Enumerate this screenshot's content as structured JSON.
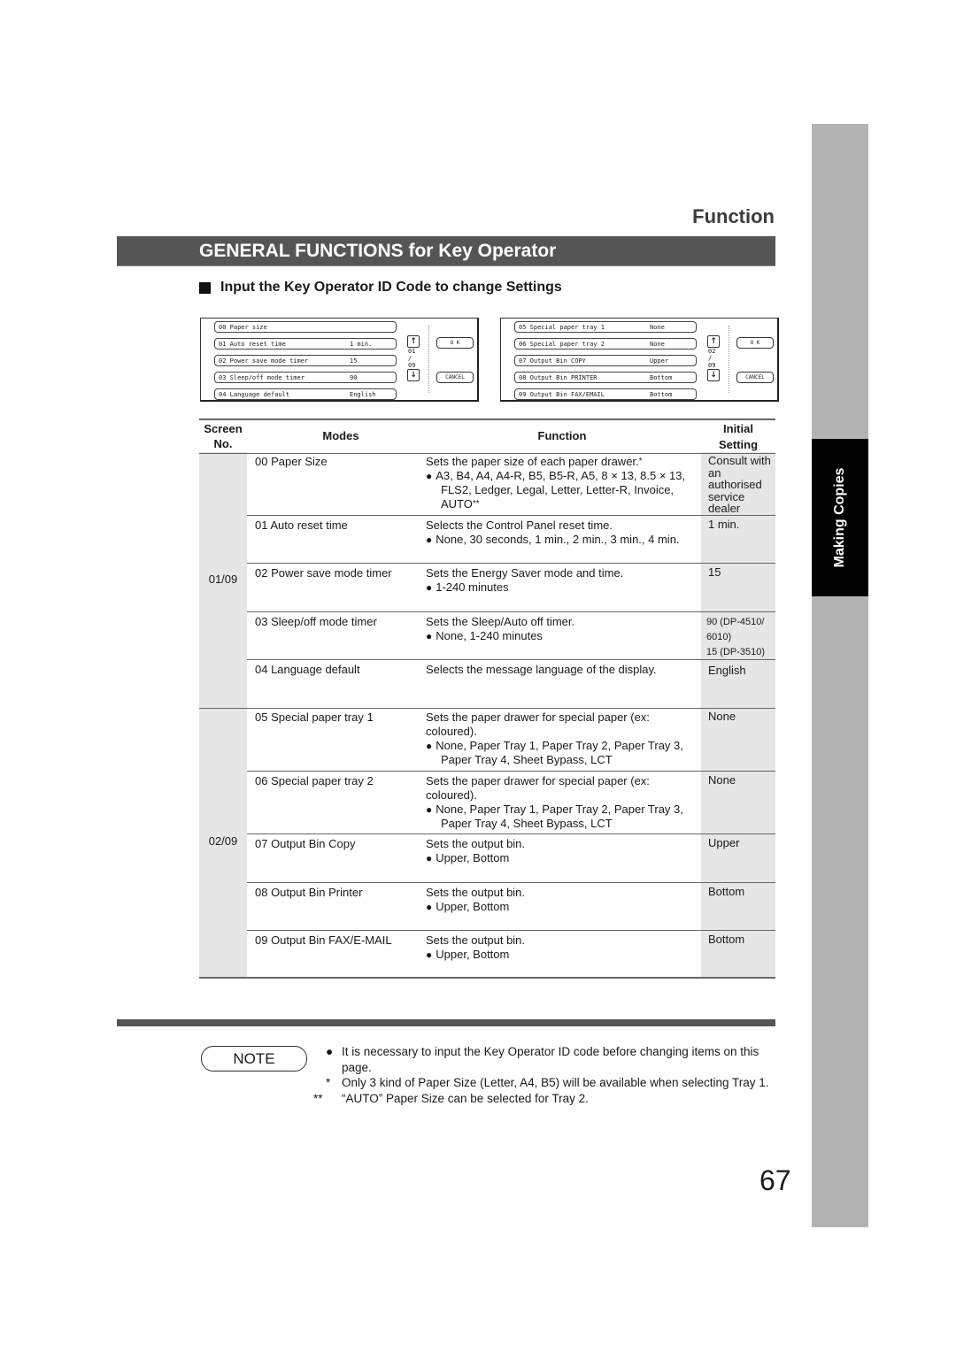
{
  "sidebar": {
    "tab_label": "Making Copies",
    "colors": {
      "tab": "#000000",
      "band": "#b3b3b3"
    }
  },
  "header": {
    "section_label": "Function",
    "title": "GENERAL FUNCTIONS for Key Operator",
    "subheading": "Input the Key Operator ID Code to change Settings"
  },
  "screens": [
    {
      "rows": [
        {
          "text": "00  Paper size",
          "value": ""
        },
        {
          "text": "01  Auto reset time",
          "value": "1 min."
        },
        {
          "text": "02  Power save mode timer",
          "value": "15"
        },
        {
          "text": "03  Sleep/off mode timer",
          "value": "90"
        },
        {
          "text": "04  Language default",
          "value": "English"
        }
      ],
      "page_current": "01",
      "page_total": "09",
      "ok_label": "O K",
      "cancel_label": "CANCEL"
    },
    {
      "rows": [
        {
          "text": "05  Special paper tray 1",
          "value": "None"
        },
        {
          "text": "06  Special paper tray 2",
          "value": "None"
        },
        {
          "text": "07  Output Bin COPY",
          "value": "Upper"
        },
        {
          "text": "08  Output Bin PRINTER",
          "value": "Bottom"
        },
        {
          "text": "09  Output Bin FAX/EMAIL",
          "value": "Bottom"
        }
      ],
      "page_current": "02",
      "page_total": "09",
      "ok_label": "O K",
      "cancel_label": "CANCEL"
    }
  ],
  "table": {
    "headers": {
      "screen_line1": "Screen",
      "screen_line2": "No.",
      "modes": "Modes",
      "function": "Function",
      "initial_line1": "Initial",
      "initial_line2": "Setting"
    },
    "groups": [
      {
        "screen_no": "01/09"
      },
      {
        "screen_no": "02/09"
      }
    ],
    "rows": [
      {
        "mode": "00 Paper Size",
        "func": "Sets the paper size of each paper drawer.",
        "func_mark": "*",
        "options": "A3, B4, A4, A4-R, B5, B5-R, A5, 8 × 13, 8.5 × 13, FLS2, Ledger, Legal, Letter, Letter-R, Invoice, AUTO",
        "options_mark": "**",
        "initial": "Consult with an authorised service dealer"
      },
      {
        "mode": "01 Auto reset time",
        "func": "Selects the Control Panel reset time.",
        "options": "None, 30 seconds, 1 min., 2 min., 3 min., 4 min.",
        "initial": "1 min."
      },
      {
        "mode": "02 Power save mode timer",
        "func": "Sets the Energy Saver mode and time.",
        "options": "1-240 minutes",
        "initial": "15"
      },
      {
        "mode": "03 Sleep/off mode timer",
        "func": "Sets the Sleep/Auto off timer.",
        "options": "None, 1-240 minutes",
        "initial_a": "90 (DP-4510/",
        "initial_b": "6010)",
        "initial_c": "15 (DP-3510)"
      },
      {
        "mode": "04 Language default",
        "func": "Selects the message language of the display.",
        "initial": "English"
      },
      {
        "mode": "05 Special paper tray 1",
        "func": "Sets the paper drawer for special paper (ex: coloured).",
        "options": "None, Paper Tray 1, Paper Tray 2, Paper Tray 3, Paper Tray 4, Sheet Bypass, LCT",
        "initial": "None"
      },
      {
        "mode": "06 Special paper tray 2",
        "func": "Sets the paper drawer for special paper (ex: coloured).",
        "options": "None, Paper Tray 1, Paper Tray 2, Paper Tray 3, Paper Tray 4, Sheet Bypass, LCT",
        "initial": "None"
      },
      {
        "mode": "07 Output Bin Copy",
        "func": "Sets the output bin.",
        "options": "Upper, Bottom",
        "initial": "Upper"
      },
      {
        "mode": "08 Output Bin Printer",
        "func": "Sets the output bin.",
        "options": "Upper, Bottom",
        "initial": "Bottom"
      },
      {
        "mode": "09 Output Bin FAX/E-MAIL",
        "func": "Sets the output bin.",
        "options": "Upper, Bottom",
        "initial": "Bottom"
      }
    ]
  },
  "note": {
    "label": "NOTE",
    "items": [
      {
        "mark": "●",
        "text": "It is necessary to input the Key Operator ID code before changing items on this page."
      },
      {
        "mark": "*",
        "text": "Only 3 kind of Paper Size (Letter, A4, B5) will be available when selecting Tray 1."
      },
      {
        "mark": "**",
        "text": "“AUTO” Paper Size can be selected for Tray 2."
      }
    ]
  },
  "page_number": "67"
}
